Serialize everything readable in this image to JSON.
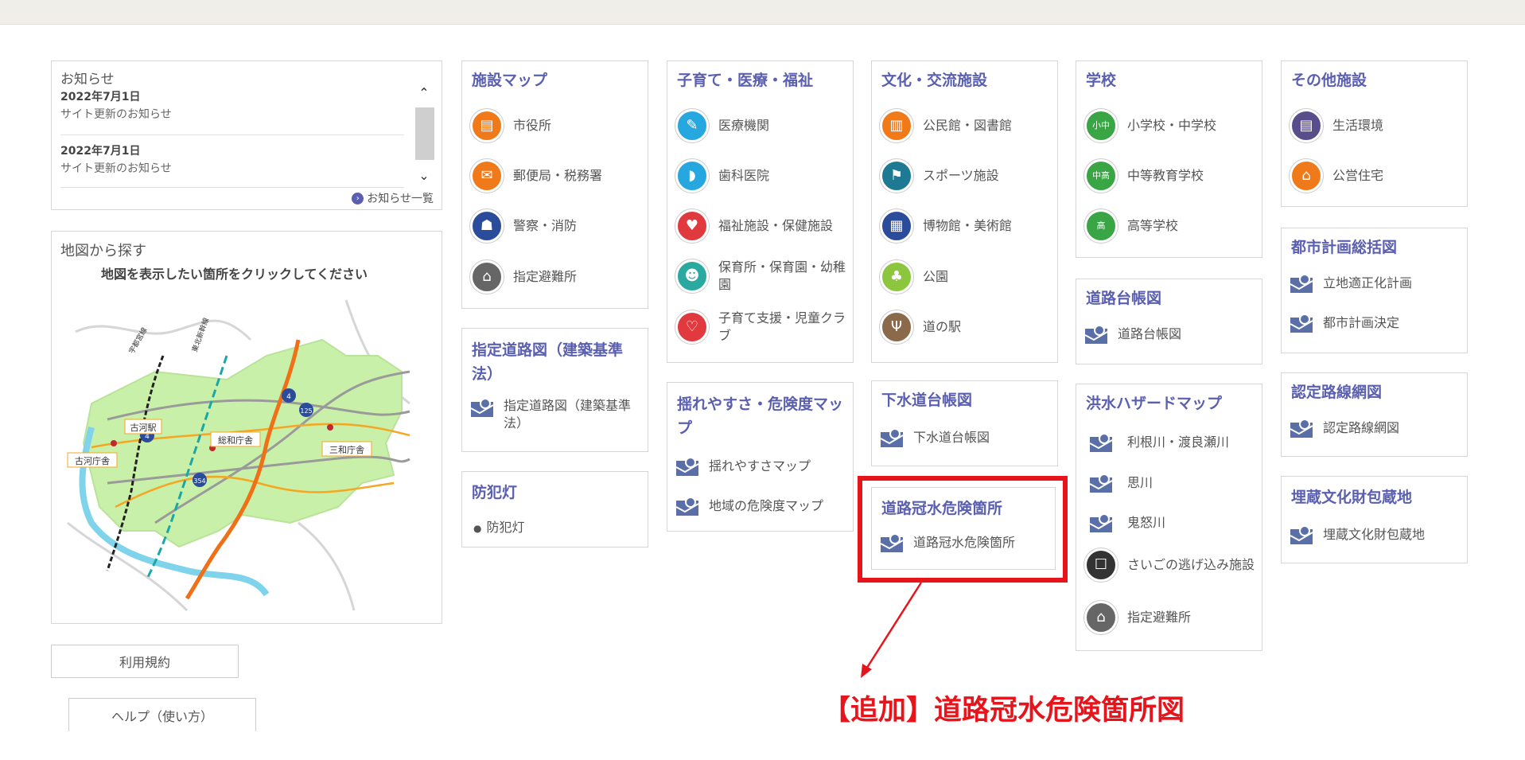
{
  "news": {
    "label": "お知らせ",
    "items": [
      {
        "date": "2022年7月1日",
        "text": "サイト更新のお知らせ"
      },
      {
        "date": "2022年7月1日",
        "text": "サイト更新のお知らせ"
      }
    ],
    "list_link": "お知らせ一覧"
  },
  "map_search": {
    "label": "地図から探す",
    "instruction": "地図を表示したい箇所をクリックしてください",
    "places": [
      "古河駅",
      "総和庁舎",
      "三和庁舎",
      "古河庁舎"
    ],
    "route_numbers": [
      "4",
      "4",
      "125",
      "354"
    ],
    "rail_labels": [
      "宇都宮線",
      "東北新幹線"
    ]
  },
  "footer_buttons": {
    "terms": "利用規約",
    "help": "ヘルプ（使い方）"
  },
  "cards": {
    "facility_map": {
      "title": "施設マップ",
      "items": [
        "市役所",
        "郵便局・税務署",
        "警察・消防",
        "指定避難所"
      ]
    },
    "designated_road": {
      "title": "指定道路図（建築基準法）",
      "items": [
        "指定道路図（建築基準法）"
      ]
    },
    "crime_light": {
      "title": "防犯灯",
      "items": [
        "防犯灯"
      ]
    },
    "childcare": {
      "title": "子育て・医療・福祉",
      "items": [
        "医療機関",
        "歯科医院",
        "福祉施設・保健施設",
        "保育所・保育園・幼稚園",
        "子育て支援・児童クラブ"
      ]
    },
    "shake": {
      "title": "揺れやすさ・危険度マップ",
      "items": [
        "揺れやすさマップ",
        "地域の危険度マップ"
      ]
    },
    "culture": {
      "title": "文化・交流施設",
      "items": [
        "公民館・図書館",
        "スポーツ施設",
        "博物館・美術館",
        "公園",
        "道の駅"
      ]
    },
    "sewer": {
      "title": "下水道台帳図",
      "items": [
        "下水道台帳図"
      ]
    },
    "flood_road": {
      "title": "道路冠水危険箇所",
      "items": [
        "道路冠水危険箇所"
      ]
    },
    "school": {
      "title": "学校",
      "items": [
        "小学校・中学校",
        "中等教育学校",
        "高等学校"
      ]
    },
    "road_ledger": {
      "title": "道路台帳図",
      "items": [
        "道路台帳図"
      ]
    },
    "flood_hazard": {
      "title": "洪水ハザードマップ",
      "items": [
        "利根川・渡良瀬川",
        "思川",
        "鬼怒川",
        "さいごの逃げ込み施設",
        "指定避難所"
      ]
    },
    "other": {
      "title": "その他施設",
      "items": [
        "生活環境",
        "公営住宅"
      ]
    },
    "city_plan": {
      "title": "都市計画総括図",
      "items": [
        "立地適正化計画",
        "都市計画決定"
      ]
    },
    "certified_road": {
      "title": "認定路線網図",
      "items": [
        "認定路線網図"
      ]
    },
    "buried": {
      "title": "埋蔵文化財包蔵地",
      "items": [
        "埋蔵文化財包蔵地"
      ]
    }
  },
  "annotation": {
    "text": "【追加】道路冠水危険箇所図",
    "color": "#e8141c"
  },
  "colors": {
    "title": "#5a5fb0",
    "highlight": "#e8141c"
  }
}
